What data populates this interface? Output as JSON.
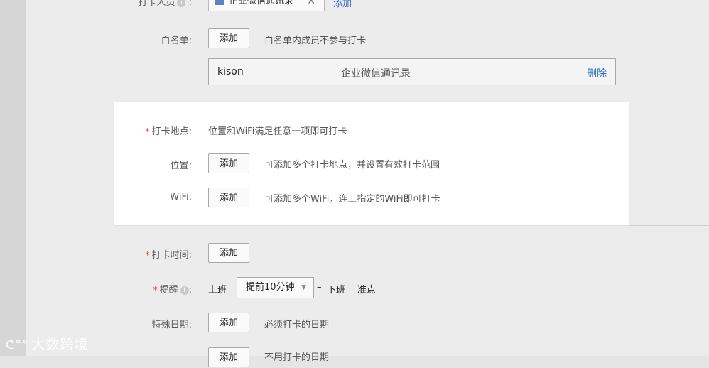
{
  "top_row": {
    "label": "打卡人员",
    "tag_text": "企业微信通讯录",
    "add_link": "添加"
  },
  "whitelist": {
    "label": "白名单:",
    "add_button": "添加",
    "hint": "白名单内成员不参与打卡",
    "row": {
      "name": "kison",
      "source": "企业微信通讯录",
      "delete": "删除"
    }
  },
  "location_section": {
    "required_mark": "*",
    "label": "打卡地点:",
    "desc": "位置和WiFi满足任意一项即可打卡",
    "position": {
      "label": "位置:",
      "add_button": "添加",
      "hint": "可添加多个打卡地点，并设置有效打卡范围"
    },
    "wifi": {
      "label": "WiFi:",
      "add_button": "添加",
      "hint": "可添加多个WiFi，连上指定的WiFi即可打卡"
    }
  },
  "time_row": {
    "required_mark": "*",
    "label": "打卡时间:",
    "add_button": "添加"
  },
  "reminder_row": {
    "required_mark": "*",
    "label": "提醒",
    "label_suffix": ":",
    "start_text": "上班",
    "select_value": "提前10分钟",
    "dash": "–",
    "end_text": "下班",
    "end_value": "准点"
  },
  "special_date": {
    "label": "特殊日期:",
    "add_button": "添加",
    "hint": "必须打卡的日期"
  },
  "partial_row": {
    "add_button": "添加",
    "hint": "不用打卡的日期"
  },
  "watermark": {
    "logo": "ᕦ°°",
    "text": "大数跨境"
  },
  "colors": {
    "link": "#2a6cc2",
    "required": "#e23c3c",
    "tag_icon": "#5b82c4"
  }
}
